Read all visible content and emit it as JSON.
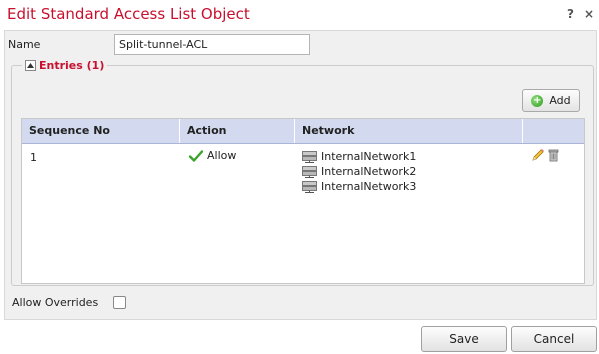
{
  "dialog": {
    "title": "Edit Standard Access List Object",
    "help_label": "?",
    "close_label": "×"
  },
  "name_field": {
    "label": "Name",
    "value": "Split-tunnel-ACL"
  },
  "entries": {
    "legend": "Entries (1)",
    "add_label": "Add",
    "columns": [
      "Sequence No",
      "Action",
      "Network",
      ""
    ],
    "rows": [
      {
        "sequence": "1",
        "action": "Allow",
        "networks": [
          "InternalNetwork1",
          "InternalNetwork2",
          "InternalNetwork3"
        ]
      }
    ]
  },
  "allow_overrides": {
    "label": "Allow Overrides",
    "checked": false
  },
  "footer": {
    "save_label": "Save",
    "cancel_label": "Cancel"
  },
  "colors": {
    "title": "#c8102e",
    "header_bg": "#d3daf0",
    "panel_bg": "#f0f0f0"
  },
  "icons": [
    "help-icon",
    "close-icon",
    "collapse-icon",
    "add-icon",
    "check-icon",
    "network-object-icon",
    "edit-pencil-icon",
    "delete-trash-icon"
  ]
}
